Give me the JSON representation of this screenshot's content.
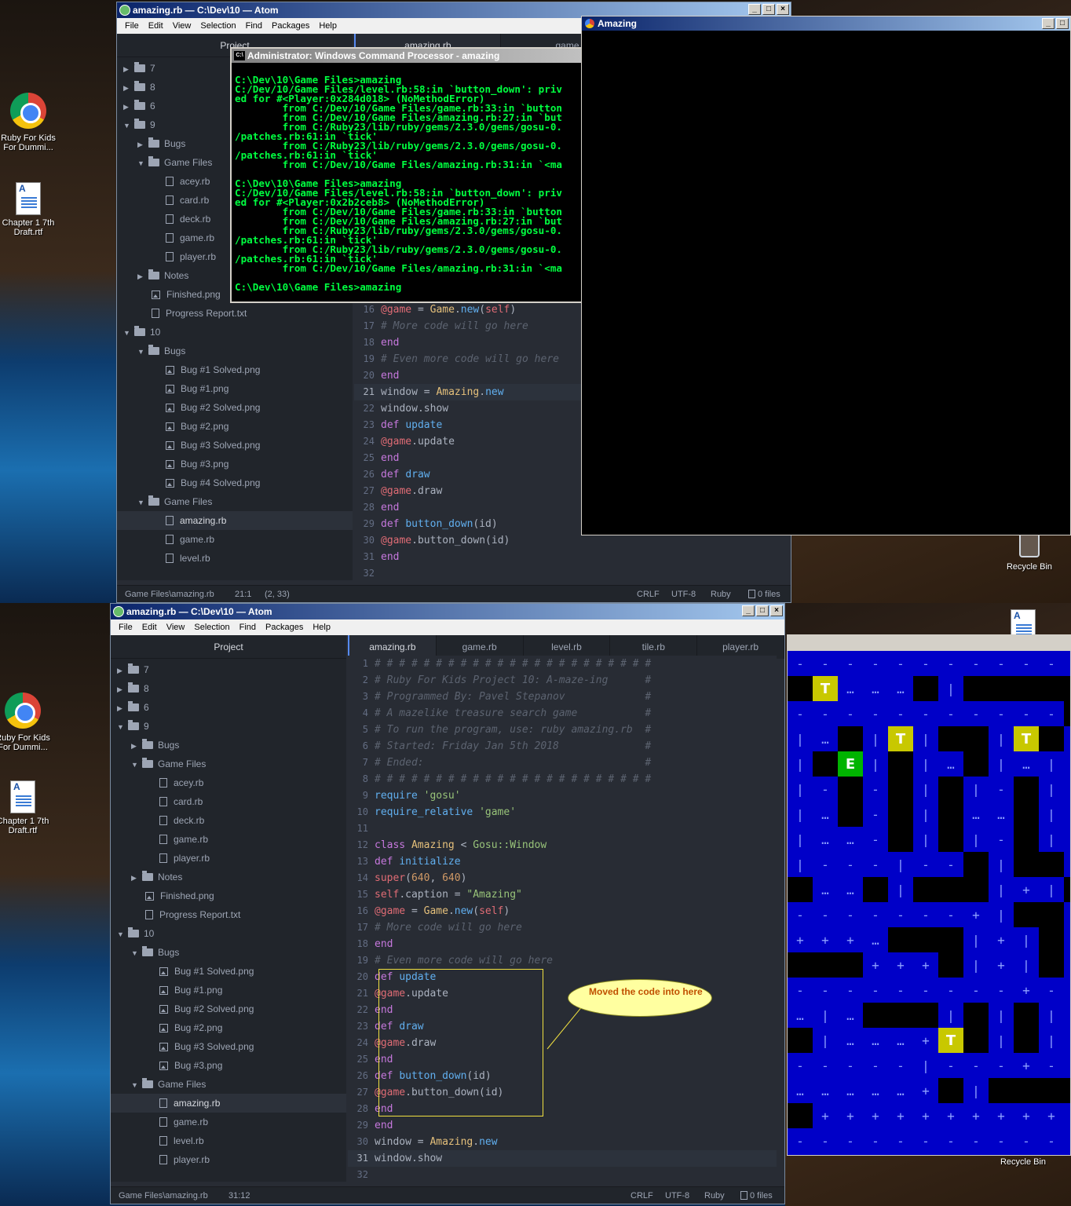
{
  "desktop": {
    "icons": [
      {
        "label": "Ruby For Kids For Dummi..."
      },
      {
        "label": "Chapter 1 7th Draft.rtf"
      },
      {
        "label": "Recycle Bin"
      }
    ]
  },
  "top": {
    "atom": {
      "title": "amazing.rb — C:\\Dev\\10 — Atom",
      "menu": [
        "File",
        "Edit",
        "View",
        "Selection",
        "Find",
        "Packages",
        "Help"
      ],
      "tree_header": "Project",
      "tabs": [
        "amazing.rb",
        "game.rb",
        "level"
      ],
      "tree": [
        {
          "type": "folder",
          "depth": 0,
          "open": false,
          "label": "7"
        },
        {
          "type": "folder",
          "depth": 0,
          "open": false,
          "label": "8"
        },
        {
          "type": "folder",
          "depth": 0,
          "open": false,
          "label": "6"
        },
        {
          "type": "folder",
          "depth": 0,
          "open": true,
          "label": "9"
        },
        {
          "type": "folder",
          "depth": 1,
          "open": false,
          "label": "Bugs"
        },
        {
          "type": "folder",
          "depth": 1,
          "open": true,
          "label": "Game Files"
        },
        {
          "type": "file",
          "depth": 2,
          "label": "acey.rb"
        },
        {
          "type": "file",
          "depth": 2,
          "label": "card.rb"
        },
        {
          "type": "file",
          "depth": 2,
          "label": "deck.rb"
        },
        {
          "type": "file",
          "depth": 2,
          "label": "game.rb"
        },
        {
          "type": "file",
          "depth": 2,
          "label": "player.rb"
        },
        {
          "type": "folder",
          "depth": 1,
          "open": false,
          "label": "Notes"
        },
        {
          "type": "img",
          "depth": 1,
          "label": "Finished.png"
        },
        {
          "type": "file",
          "depth": 1,
          "label": "Progress Report.txt"
        },
        {
          "type": "folder",
          "depth": 0,
          "open": true,
          "label": "10"
        },
        {
          "type": "folder",
          "depth": 1,
          "open": true,
          "label": "Bugs"
        },
        {
          "type": "img",
          "depth": 2,
          "label": "Bug #1 Solved.png"
        },
        {
          "type": "img",
          "depth": 2,
          "label": "Bug #1.png"
        },
        {
          "type": "img",
          "depth": 2,
          "label": "Bug #2 Solved.png"
        },
        {
          "type": "img",
          "depth": 2,
          "label": "Bug #2.png"
        },
        {
          "type": "img",
          "depth": 2,
          "label": "Bug #3 Solved.png"
        },
        {
          "type": "img",
          "depth": 2,
          "label": "Bug #3.png"
        },
        {
          "type": "img",
          "depth": 2,
          "label": "Bug #4 Solved.png"
        },
        {
          "type": "folder",
          "depth": 1,
          "open": true,
          "label": "Game Files"
        },
        {
          "type": "file",
          "depth": 2,
          "label": "amazing.rb",
          "selected": true
        },
        {
          "type": "file",
          "depth": 2,
          "label": "game.rb"
        },
        {
          "type": "file",
          "depth": 2,
          "label": "level.rb"
        }
      ],
      "code": [
        {
          "n": "16",
          "html": "<span class='c-iv'>@game</span><span class='c-tx'> = </span><span class='c-cls'>Game</span><span class='c-tx'>.</span><span class='c-fn'>new</span><span class='c-tx'>(</span><span class='c-iv'>self</span><span class='c-tx'>)</span>"
        },
        {
          "n": "17",
          "html": "<span class='c-cm'># More code will go here</span>"
        },
        {
          "n": "18",
          "html": "<span class='c-kw'>end</span>"
        },
        {
          "n": "19",
          "html": "<span class='c-cm'># Even more code will go here</span>"
        },
        {
          "n": "20",
          "html": "<span class='c-kw'>end</span>"
        },
        {
          "n": "21",
          "html": "<span class='c-tx'>window = </span><span class='c-cls'>Amazing</span><span class='c-tx'>.</span><span class='c-fn'>new</span>",
          "cur": true
        },
        {
          "n": "22",
          "html": "<span class='c-tx'>window.show</span>"
        },
        {
          "n": "23",
          "html": "<span class='c-kw'>def</span><span class='c-tx'> </span><span class='c-fn'>update</span>"
        },
        {
          "n": "24",
          "html": "<span class='c-iv'>@game</span><span class='c-tx'>.update</span>"
        },
        {
          "n": "25",
          "html": "<span class='c-kw'>end</span>"
        },
        {
          "n": "26",
          "html": "<span class='c-kw'>def</span><span class='c-tx'> </span><span class='c-fn'>draw</span>"
        },
        {
          "n": "27",
          "html": "<span class='c-iv'>@game</span><span class='c-tx'>.draw</span>"
        },
        {
          "n": "28",
          "html": "<span class='c-kw'>end</span>"
        },
        {
          "n": "29",
          "html": "<span class='c-kw'>def</span><span class='c-tx'> </span><span class='c-fn'>button_down</span><span class='c-tx'>(id)</span>"
        },
        {
          "n": "30",
          "html": "<span class='c-iv'>@game</span><span class='c-tx'>.button_down(id)</span>"
        },
        {
          "n": "31",
          "html": "<span class='c-kw'>end</span>"
        },
        {
          "n": "32",
          "html": ""
        }
      ],
      "status": {
        "path": "Game Files\\amazing.rb",
        "cursor": "21:1",
        "sel": "(2, 33)",
        "eol": "CRLF",
        "enc": "UTF-8",
        "grammar": "Ruby",
        "files": "0 files"
      }
    },
    "cmd": {
      "title": "Administrator: Windows Command Processor - amazing",
      "text": "\nC:\\Dev\\10\\Game Files>amazing\nC:/Dev/10/Game Files/level.rb:58:in `button_down': priv\ned for #<Player:0x284d018> (NoMethodError)\n        from C:/Dev/10/Game Files/game.rb:33:in `button\n        from C:/Dev/10/Game Files/amazing.rb:27:in `but\n        from C:/Ruby23/lib/ruby/gems/2.3.0/gems/gosu-0.\n/patches.rb:61:in `tick'\n        from C:/Ruby23/lib/ruby/gems/2.3.0/gems/gosu-0.\n/patches.rb:61:in `tick'\n        from C:/Dev/10/Game Files/amazing.rb:31:in `<ma\n\nC:\\Dev\\10\\Game Files>amazing\nC:/Dev/10/Game Files/level.rb:58:in `button_down': priv\ned for #<Player:0x2b2ceb8> (NoMethodError)\n        from C:/Dev/10/Game Files/game.rb:33:in `button\n        from C:/Dev/10/Game Files/amazing.rb:27:in `but\n        from C:/Ruby23/lib/ruby/gems/2.3.0/gems/gosu-0.\n/patches.rb:61:in `tick'\n        from C:/Ruby23/lib/ruby/gems/2.3.0/gems/gosu-0.\n/patches.rb:61:in `tick'\n        from C:/Dev/10/Game Files/amazing.rb:31:in `<ma\n\nC:\\Dev\\10\\Game Files>amazing"
    },
    "game_title": "Amazing"
  },
  "bottom": {
    "atom": {
      "title": "amazing.rb — C:\\Dev\\10 — Atom",
      "menu": [
        "File",
        "Edit",
        "View",
        "Selection",
        "Find",
        "Packages",
        "Help"
      ],
      "tree_header": "Project",
      "tabs": [
        "amazing.rb",
        "game.rb",
        "level.rb",
        "tile.rb",
        "player.rb"
      ],
      "tree": [
        {
          "type": "folder",
          "depth": 0,
          "open": false,
          "label": "7"
        },
        {
          "type": "folder",
          "depth": 0,
          "open": false,
          "label": "8"
        },
        {
          "type": "folder",
          "depth": 0,
          "open": false,
          "label": "6"
        },
        {
          "type": "folder",
          "depth": 0,
          "open": true,
          "label": "9"
        },
        {
          "type": "folder",
          "depth": 1,
          "open": false,
          "label": "Bugs"
        },
        {
          "type": "folder",
          "depth": 1,
          "open": true,
          "label": "Game Files"
        },
        {
          "type": "file",
          "depth": 2,
          "label": "acey.rb"
        },
        {
          "type": "file",
          "depth": 2,
          "label": "card.rb"
        },
        {
          "type": "file",
          "depth": 2,
          "label": "deck.rb"
        },
        {
          "type": "file",
          "depth": 2,
          "label": "game.rb"
        },
        {
          "type": "file",
          "depth": 2,
          "label": "player.rb"
        },
        {
          "type": "folder",
          "depth": 1,
          "open": false,
          "label": "Notes"
        },
        {
          "type": "img",
          "depth": 1,
          "label": "Finished.png"
        },
        {
          "type": "file",
          "depth": 1,
          "label": "Progress Report.txt"
        },
        {
          "type": "folder",
          "depth": 0,
          "open": true,
          "label": "10"
        },
        {
          "type": "folder",
          "depth": 1,
          "open": true,
          "label": "Bugs"
        },
        {
          "type": "img",
          "depth": 2,
          "label": "Bug #1 Solved.png"
        },
        {
          "type": "img",
          "depth": 2,
          "label": "Bug #1.png"
        },
        {
          "type": "img",
          "depth": 2,
          "label": "Bug #2 Solved.png"
        },
        {
          "type": "img",
          "depth": 2,
          "label": "Bug #2.png"
        },
        {
          "type": "img",
          "depth": 2,
          "label": "Bug #3 Solved.png"
        },
        {
          "type": "img",
          "depth": 2,
          "label": "Bug #3.png"
        },
        {
          "type": "folder",
          "depth": 1,
          "open": true,
          "label": "Game Files"
        },
        {
          "type": "file",
          "depth": 2,
          "label": "amazing.rb",
          "selected": true
        },
        {
          "type": "file",
          "depth": 2,
          "label": "game.rb"
        },
        {
          "type": "file",
          "depth": 2,
          "label": "level.rb"
        },
        {
          "type": "file",
          "depth": 2,
          "label": "player.rb"
        }
      ],
      "code": [
        {
          "n": "1",
          "html": "<span class='c-cm'># # # # # # # # # # # # # # # # # # # # # # #</span>"
        },
        {
          "n": "2",
          "html": "<span class='c-cm'># Ruby For Kids Project 10: A-maze-ing      #</span>"
        },
        {
          "n": "3",
          "html": "<span class='c-cm'># Programmed By: Pavel Stepanov             #</span>"
        },
        {
          "n": "4",
          "html": "<span class='c-cm'># A mazelike treasure search game           #</span>"
        },
        {
          "n": "5",
          "html": "<span class='c-cm'># To run the program, use: ruby amazing.rb  #</span>"
        },
        {
          "n": "6",
          "html": "<span class='c-cm'># Started: Friday Jan 5th 2018              #</span>"
        },
        {
          "n": "7",
          "html": "<span class='c-cm'># Ended:                                    #</span>"
        },
        {
          "n": "8",
          "html": "<span class='c-cm'># # # # # # # # # # # # # # # # # # # # # # #</span>"
        },
        {
          "n": "9",
          "html": "<span class='c-fn'>require</span><span class='c-tx'> </span><span class='c-str'>'gosu'</span>"
        },
        {
          "n": "10",
          "html": "<span class='c-fn'>require_relative</span><span class='c-tx'> </span><span class='c-str'>'game'</span>"
        },
        {
          "n": "11",
          "html": ""
        },
        {
          "n": "12",
          "html": "<span class='c-kw'>class</span><span class='c-tx'> </span><span class='c-cls'>Amazing</span><span class='c-tx'> &lt; </span><span class='c-str'>Gosu::Window</span>"
        },
        {
          "n": "13",
          "html": "<span class='c-kw'>def</span><span class='c-tx'> </span><span class='c-fn'>initialize</span>"
        },
        {
          "n": "14",
          "html": "<span class='c-iv'>super</span><span class='c-tx'>(</span><span class='c-num'>640</span><span class='c-tx'>, </span><span class='c-num'>640</span><span class='c-tx'>)</span>"
        },
        {
          "n": "15",
          "html": "<span class='c-iv'>self</span><span class='c-tx'>.caption = </span><span class='c-str'>\"Amazing\"</span>"
        },
        {
          "n": "16",
          "html": "<span class='c-iv'>@game</span><span class='c-tx'> = </span><span class='c-cls'>Game</span><span class='c-tx'>.</span><span class='c-fn'>new</span><span class='c-tx'>(</span><span class='c-iv'>self</span><span class='c-tx'>)</span>"
        },
        {
          "n": "17",
          "html": "<span class='c-cm'># More code will go here</span>"
        },
        {
          "n": "18",
          "html": "<span class='c-kw'>end</span>"
        },
        {
          "n": "19",
          "html": "<span class='c-cm'># Even more code will go here</span>"
        },
        {
          "n": "20",
          "html": "<span class='c-kw'>def</span><span class='c-tx'> </span><span class='c-fn'>update</span>"
        },
        {
          "n": "21",
          "html": "<span class='c-iv'>@game</span><span class='c-tx'>.update</span>"
        },
        {
          "n": "22",
          "html": "<span class='c-kw'>end</span>"
        },
        {
          "n": "23",
          "html": "<span class='c-kw'>def</span><span class='c-tx'> </span><span class='c-fn'>draw</span>"
        },
        {
          "n": "24",
          "html": "<span class='c-iv'>@game</span><span class='c-tx'>.draw</span>"
        },
        {
          "n": "25",
          "html": "<span class='c-kw'>end</span>"
        },
        {
          "n": "26",
          "html": "<span class='c-kw'>def</span><span class='c-tx'> </span><span class='c-fn'>button_down</span><span class='c-tx'>(id)</span>"
        },
        {
          "n": "27",
          "html": "<span class='c-iv'>@game</span><span class='c-tx'>.button_down(id)</span>"
        },
        {
          "n": "28",
          "html": "<span class='c-kw'>end</span>"
        },
        {
          "n": "29",
          "html": "<span class='c-kw'>end</span>"
        },
        {
          "n": "30",
          "html": "<span class='c-tx'>window = </span><span class='c-cls'>Amazing</span><span class='c-tx'>.</span><span class='c-fn'>new</span>"
        },
        {
          "n": "31",
          "html": "<span class='c-tx'>window.show</span>",
          "cur": true
        },
        {
          "n": "32",
          "html": ""
        }
      ],
      "annotation": "Moved the code into here",
      "status": {
        "path": "Game Files\\amazing.rb",
        "cursor": "31:12",
        "eol": "CRLF",
        "enc": "UTF-8",
        "grammar": "Ruby",
        "files": "0 files"
      }
    },
    "maze": {
      "colors": {
        "wall": "#000000",
        "floor": "#0000c8",
        "treasure": "#c8c800",
        "exit": "#00b400"
      },
      "rows": [
        "--------------",
        "#T...#|#######",
        "-----------##|",
        "|.#|T|##|T#|.|",
        "|#E|#|.#|.|.|",
        "|-#-#|#|-#|-|",
        "|.#-#|#..#|.#",
        "|..-#|#|-#|.#",
        "|---|--#|##|#",
        "#..#|###|+|#|",
        "-------+|##|",
        "+++.###|+|#|",
        "###+++#|+|#|",
        "---------+-|",
        ".|.###|#|#|",
        "#|...+T#|#||",
        "-----|---+--",
        ".....+#|####",
        "#+++++++++++",
        "-----------"
      ]
    }
  }
}
